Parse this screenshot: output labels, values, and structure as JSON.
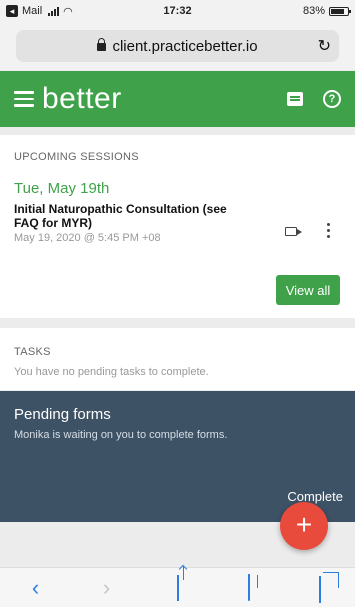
{
  "status_bar": {
    "back_app": "Mail",
    "time": "17:32",
    "battery": "83%"
  },
  "browser": {
    "url": "client.practicebetter.io"
  },
  "header": {
    "brand": "better"
  },
  "sessions": {
    "section_title": "UPCOMING SESSIONS",
    "date": "Tue, May 19th",
    "title": "Initial Naturopathic Consultation (see FAQ for MYR)",
    "time": "May 19, 2020 @ 5:45 PM +08",
    "view_all_label": "View all"
  },
  "tasks": {
    "section_title": "TASKS",
    "empty_text": "You have no pending tasks to complete."
  },
  "pending_forms": {
    "title": "Pending forms",
    "text": "Monika is waiting on you to complete forms.",
    "action_label": "Complete"
  },
  "fab": {
    "label": "+"
  },
  "toolbar": {
    "back": "‹",
    "forward": "›"
  },
  "colors": {
    "brand_green": "#3fa24a",
    "pending_bg": "#3e5266",
    "fab_red": "#e84b3c",
    "ios_blue": "#2c7fe0"
  }
}
